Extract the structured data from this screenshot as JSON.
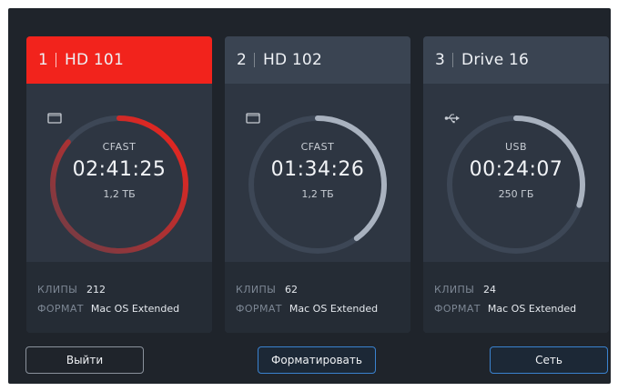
{
  "cards": [
    {
      "number": "1",
      "name": "HD 101",
      "media": "CFAST",
      "media_icon": "card-icon",
      "timecode": "02:41:25",
      "capacity": "1,2 ТБ",
      "fill_fraction": 0.86,
      "ring_color": "#f2231c",
      "active": true,
      "clips_label": "КЛИПЫ",
      "clips_value": "212",
      "format_label": "ФОРМАТ",
      "format_value": "Mac OS Extended"
    },
    {
      "number": "2",
      "name": "HD 102",
      "media": "CFAST",
      "media_icon": "card-icon",
      "timecode": "01:34:26",
      "capacity": "1,2 ТБ",
      "fill_fraction": 0.4,
      "ring_color": "#a9b2bf",
      "active": false,
      "clips_label": "КЛИПЫ",
      "clips_value": "62",
      "format_label": "ФОРМАТ",
      "format_value": "Mac OS Extended"
    },
    {
      "number": "3",
      "name": "Drive 16",
      "media": "USB",
      "media_icon": "usb-icon",
      "timecode": "00:24:07",
      "capacity": "250 ГБ",
      "fill_fraction": 0.3,
      "ring_color": "#a9b2bf",
      "active": false,
      "clips_label": "КЛИПЫ",
      "clips_value": "24",
      "format_label": "ФОРМАТ",
      "format_value": "Mac OS Extended"
    }
  ],
  "buttons": {
    "exit_label": "Выйти",
    "format_label": "Форматировать",
    "network_label": "Сеть"
  },
  "colors": {
    "accent_red": "#f2231c",
    "accent_blue": "#3a82cf",
    "ring_track": "#3d4756"
  }
}
